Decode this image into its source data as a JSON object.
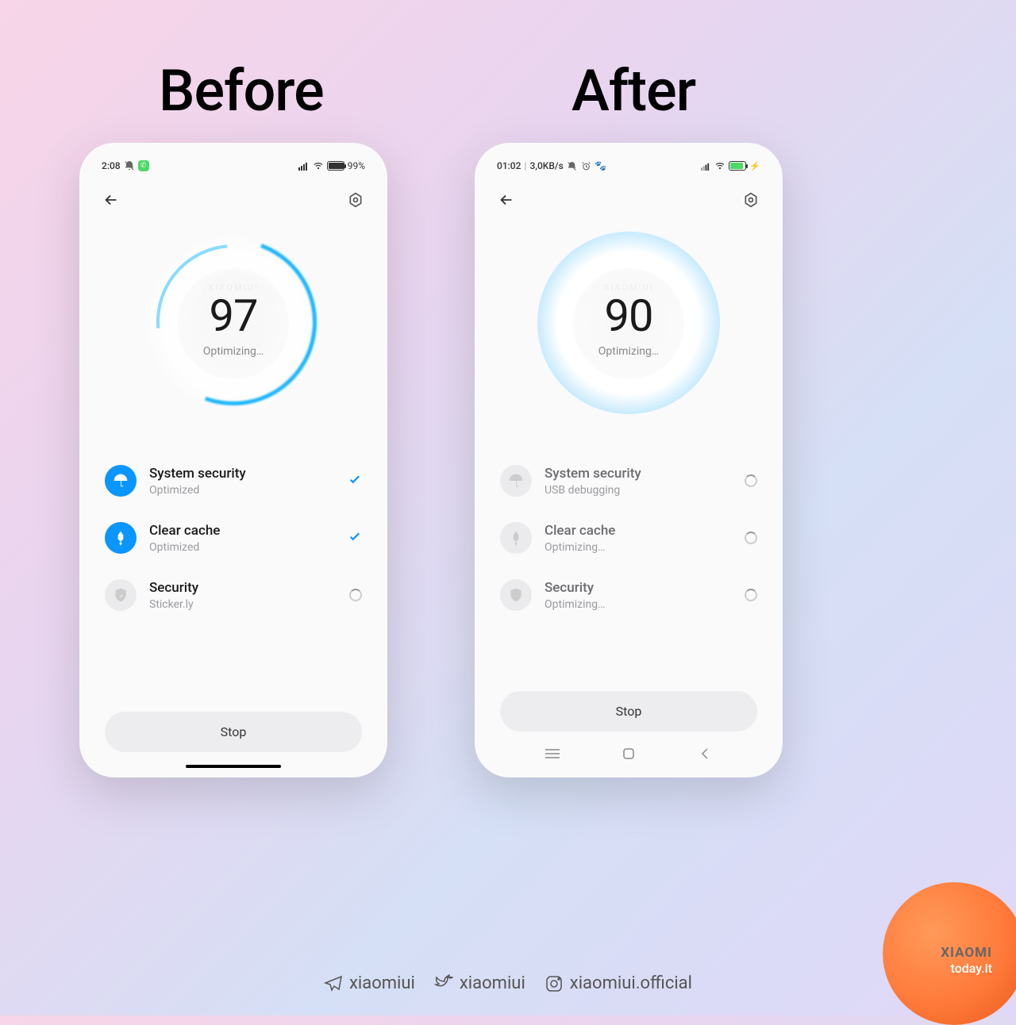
{
  "headings": {
    "before": "Before",
    "after": "After"
  },
  "before": {
    "status": {
      "time": "2:08",
      "battery_pct": "99%"
    },
    "score": {
      "value": "97",
      "label": "Optimizing…"
    },
    "items": [
      {
        "title": "System security",
        "sub": "Optimized",
        "state": "done",
        "icon": "umbrella"
      },
      {
        "title": "Clear cache",
        "sub": "Optimized",
        "state": "done",
        "icon": "rocket"
      },
      {
        "title": "Security",
        "sub": "Sticker.ly",
        "state": "loading",
        "icon": "shield"
      }
    ],
    "stop_label": "Stop"
  },
  "after": {
    "status": {
      "time": "01:02",
      "speed": "3,0KB/s",
      "battery_pct": ""
    },
    "score": {
      "value": "90",
      "label": "Optimizing…"
    },
    "items": [
      {
        "title": "System security",
        "sub": "USB debugging",
        "state": "loading",
        "icon": "umbrella"
      },
      {
        "title": "Clear cache",
        "sub": "Optimizing…",
        "state": "loading",
        "icon": "rocket"
      },
      {
        "title": "Security",
        "sub": "Optimizing…",
        "state": "loading",
        "icon": "shield"
      }
    ],
    "stop_label": "Stop"
  },
  "footer": {
    "telegram": "xiaomiui",
    "twitter": "xiaomiui",
    "instagram": "xiaomiui.official"
  },
  "badge": {
    "brand": "XIAOMI",
    "site": "today.it"
  }
}
